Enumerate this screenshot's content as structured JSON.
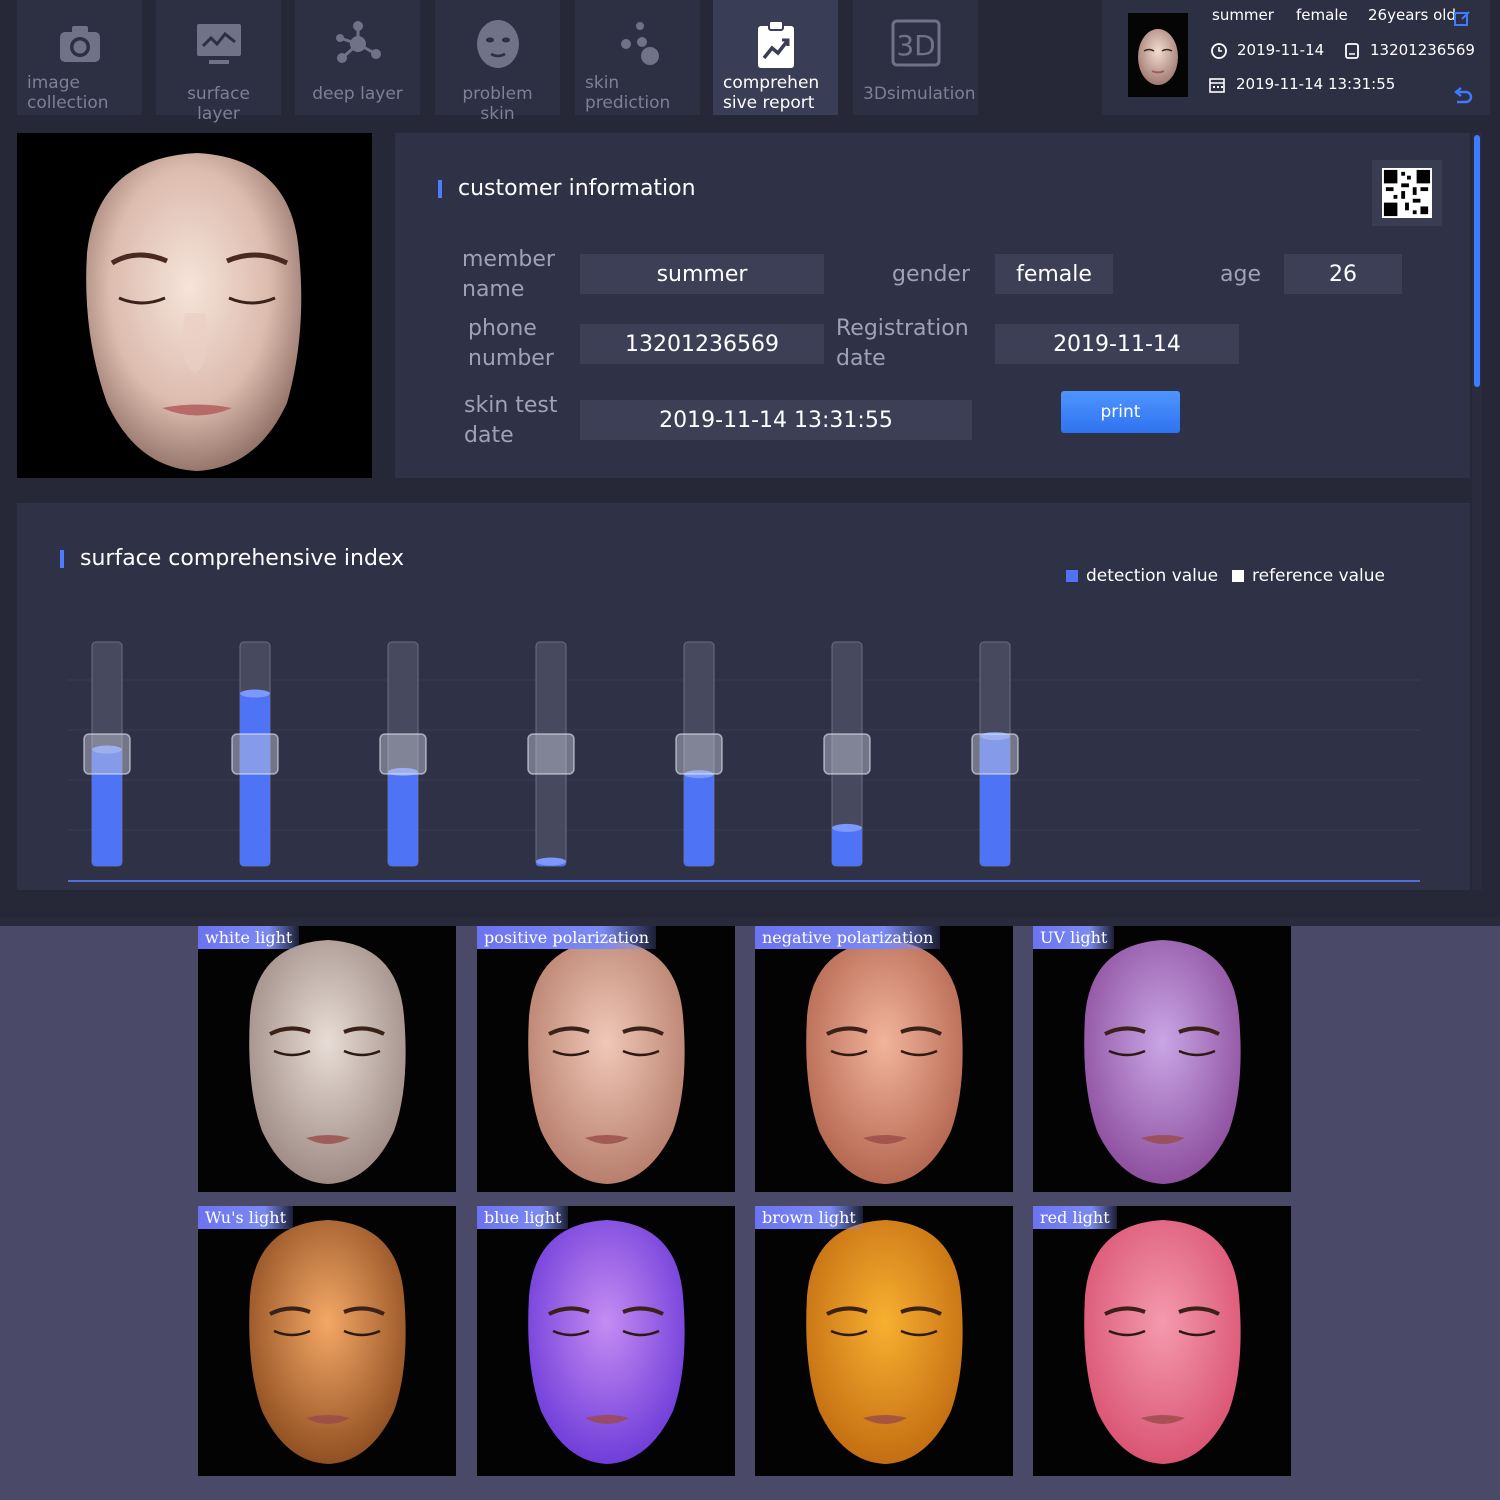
{
  "tabs": [
    {
      "label": "image collection",
      "icon": "camera-icon",
      "active": false
    },
    {
      "label": "surface layer",
      "icon": "monitor-chart-icon",
      "active": false
    },
    {
      "label": "deep layer",
      "icon": "molecule-icon",
      "active": false
    },
    {
      "label": "problem skin",
      "icon": "face-mask-icon",
      "active": false
    },
    {
      "label": "skin prediction",
      "icon": "dots-icon",
      "active": false
    },
    {
      "label": "comprehensive report",
      "icon": "clipboard-chart-icon",
      "active": true
    },
    {
      "label": "3Dsimulation",
      "icon": "3d-icon",
      "active": false
    }
  ],
  "profile": {
    "name": "summer",
    "gender": "female",
    "age_text": "26years old",
    "date": "2019-11-14",
    "phone": "13201236569",
    "datetime": "2019-11-14 13:31:55"
  },
  "customer": {
    "title": "customer information",
    "member_name_label": "member name",
    "member_name": "summer",
    "gender_label": "gender",
    "gender": "female",
    "age_label": "age",
    "age": "26",
    "phone_label": "phone number",
    "phone": "13201236569",
    "registration_label": "Registration date",
    "registration_date": "2019-11-14",
    "skin_test_label": "skin test date",
    "skin_test_date": "2019-11-14 13:31:55",
    "print_label": "print"
  },
  "index": {
    "title": "surface comprehensive index",
    "legend_detection": "detection value",
    "legend_reference": "reference value",
    "colors": {
      "detection": "#4f73f5",
      "reference": "#ffffff"
    }
  },
  "chart_data": {
    "type": "bar",
    "series": [
      {
        "name": "detection value",
        "values": [
          0.52,
          0.77,
          0.42,
          0.02,
          0.41,
          0.17,
          0.58
        ]
      },
      {
        "name": "reference value",
        "values": [
          0.5,
          0.5,
          0.5,
          0.5,
          0.5,
          0.5,
          0.5
        ]
      }
    ],
    "ylim": [
      0,
      1
    ],
    "grid": true
  },
  "gallery": [
    {
      "label": "white light",
      "tone": "#e8ddd6",
      "tone2": "#9a8680"
    },
    {
      "label": "positive polarization",
      "tone": "#f0c8b8",
      "tone2": "#b47a68"
    },
    {
      "label": "negative polarization",
      "tone": "#f2b49c",
      "tone2": "#b0624c"
    },
    {
      "label": "UV light",
      "tone": "#c9a6e6",
      "tone2": "#8a4a9a"
    },
    {
      "label": "Wu's light",
      "tone": "#f4a866",
      "tone2": "#8a4a1e"
    },
    {
      "label": "blue light",
      "tone": "#c58cf2",
      "tone2": "#6a38d8"
    },
    {
      "label": "brown light",
      "tone": "#f8b030",
      "tone2": "#c06a10"
    },
    {
      "label": "red light",
      "tone": "#f49aae",
      "tone2": "#d85070"
    }
  ]
}
